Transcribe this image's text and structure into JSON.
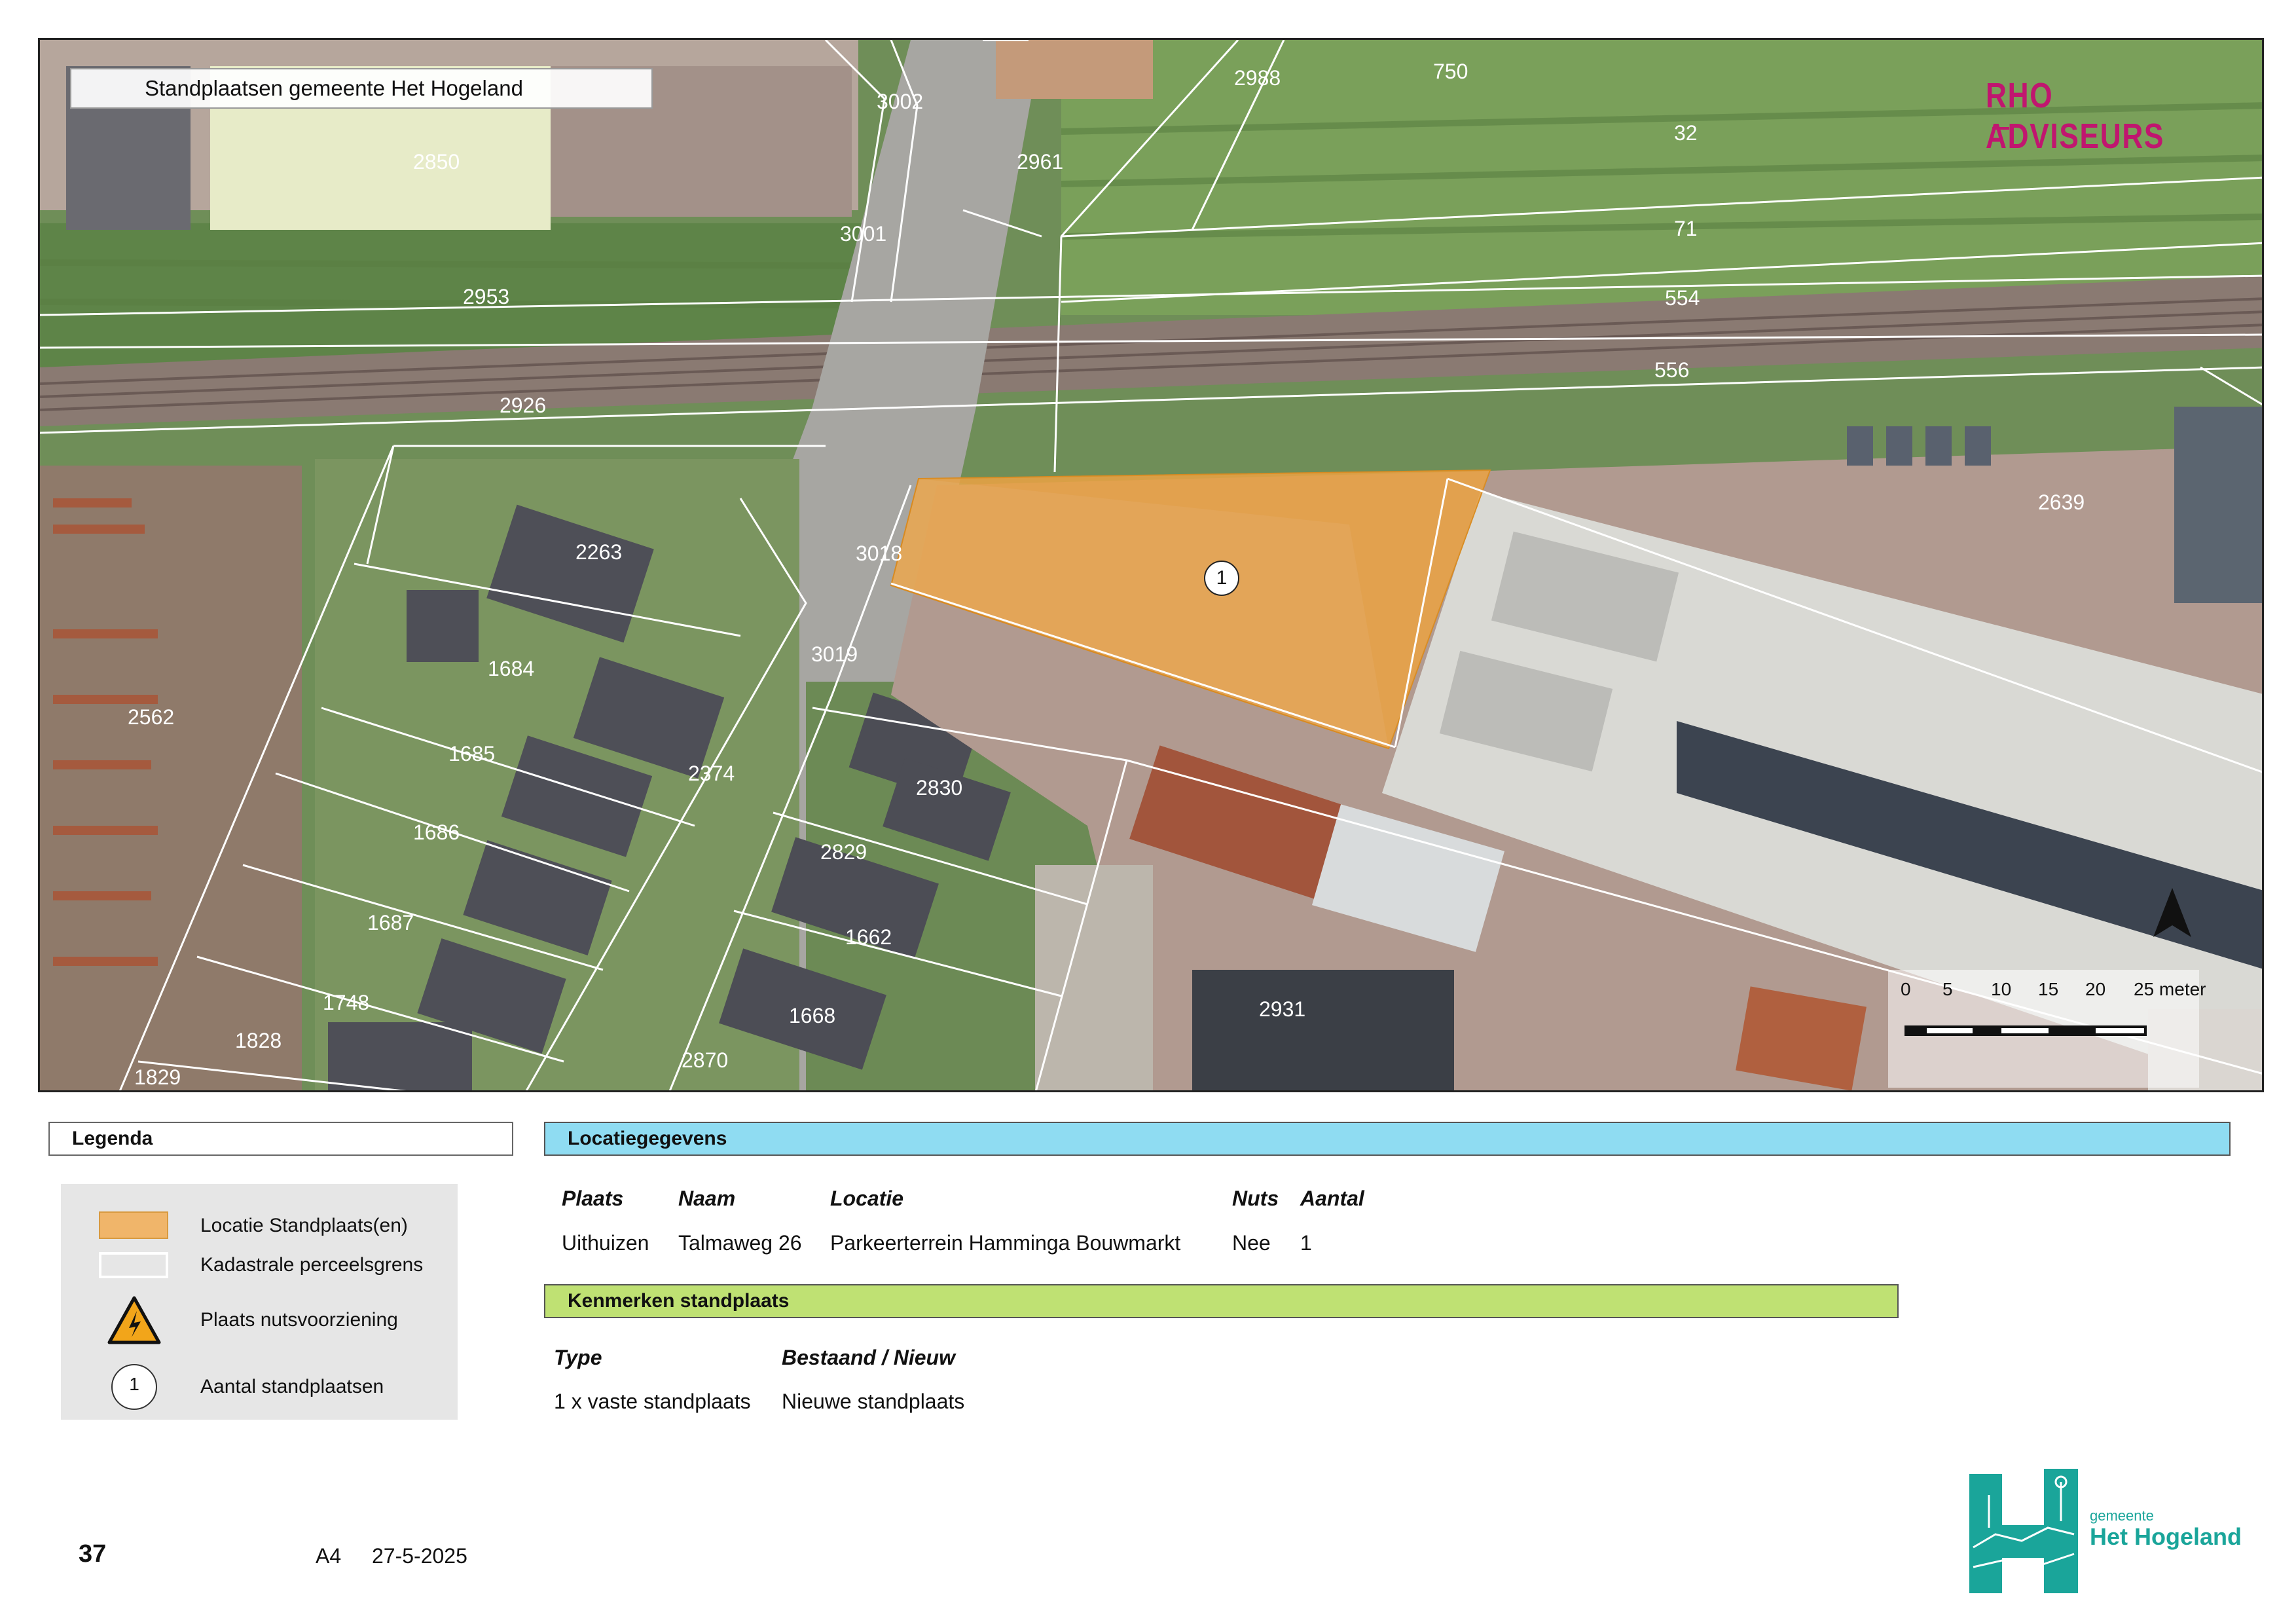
{
  "map": {
    "title": "Standplaatsen gemeente Het Hogeland",
    "brand": "RHO ADVISEURS",
    "parcels": [
      "2988",
      "750",
      "3002",
      "2961",
      "32",
      "2850",
      "71",
      "3001",
      "2953",
      "554",
      "2926",
      "556",
      "2639",
      "2263",
      "3018",
      "3019",
      "1684",
      "2562",
      "1685",
      "2374",
      "2830",
      "1686",
      "2829",
      "1687",
      "1662",
      "1748",
      "1668",
      "2931",
      "1828",
      "1829",
      "2870"
    ],
    "marker_number": "1",
    "north_arrow": "north-arrow-icon",
    "scale_bar": {
      "ticks": [
        "0",
        "5",
        "10",
        "15",
        "20",
        "25 meter"
      ]
    }
  },
  "legend": {
    "title": "Legenda",
    "items": [
      {
        "label": "Locatie Standplaats(en)",
        "color": "#f0a84a",
        "icon": "orange-area-swatch"
      },
      {
        "label": "Kadastrale perceelsgrens",
        "icon": "parcel-boundary-swatch"
      },
      {
        "label": "Plaats nutsvoorziening",
        "icon": "electricity-warning-icon"
      },
      {
        "label": "Aantal standplaatsen",
        "icon": "count-circle-icon",
        "symbol": "1"
      }
    ]
  },
  "locatie": {
    "title": "Locatiegegevens",
    "headers": [
      "Plaats",
      "Naam",
      "Locatie",
      "Nuts",
      "Aantal"
    ],
    "row": [
      "Uithuizen",
      "Talmaweg 26",
      "Parkeerterrein Hamminga Bouwmarkt",
      "Nee",
      "1"
    ]
  },
  "kenmerken": {
    "title": "Kenmerken standplaats",
    "headers": [
      "Type",
      "Bestaand / Nieuw"
    ],
    "row": [
      "1 x vaste standplaats",
      "Nieuwe standplaats"
    ]
  },
  "footer": {
    "page": "37",
    "format": "A4",
    "date": "27-5-2025"
  },
  "logo": {
    "line1": "gemeente",
    "line2": "Het Hogeland",
    "color": "#1aa59a"
  }
}
